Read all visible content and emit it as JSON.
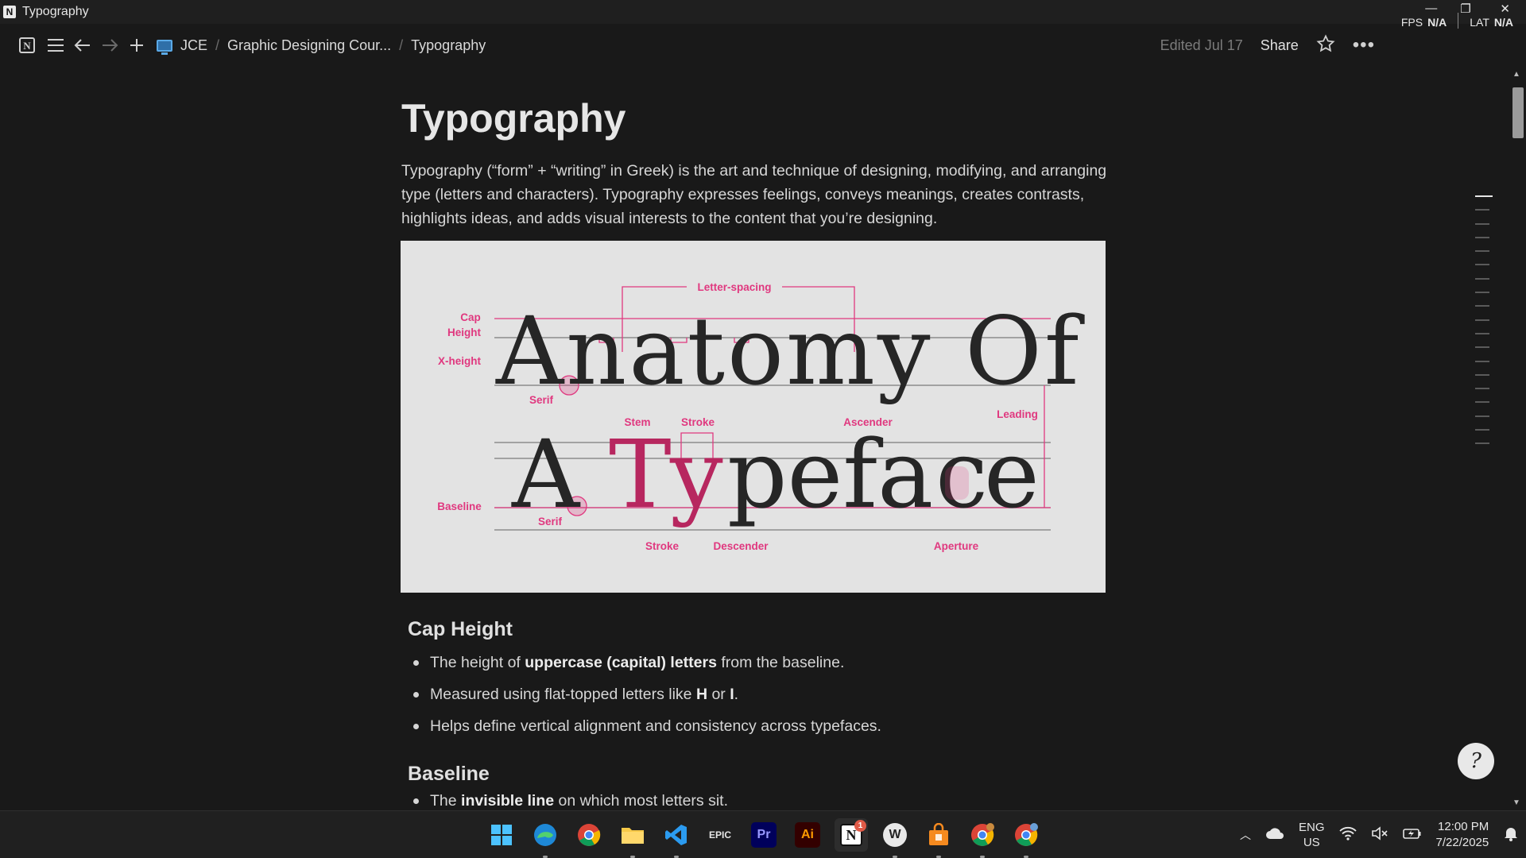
{
  "window": {
    "title": "Typography",
    "app_icon": "N"
  },
  "overlay": {
    "fps_label": "FPS",
    "fps_value": "N/A",
    "lat_label": "LAT",
    "lat_value": "N/A"
  },
  "toolbar": {
    "breadcrumbs": [
      "JCE",
      "Graphic Designing Cour...",
      "Typography"
    ],
    "edited": "Edited Jul 17",
    "share": "Share"
  },
  "page": {
    "title": "Typography",
    "intro": "Typography (“form” + “writing” in Greek) is the art and technique of designing, modifying, and arranging type (letters and characters). Typography expresses feelings, conveys meanings, creates contrasts, highlights ideas, and adds  visual interests to the content that you’re designing."
  },
  "figure": {
    "line1": "Anatomy Of",
    "line2_a": "A",
    "line2_T": "T",
    "line2_y": "y",
    "line2_pefa": "pefa",
    "line2_c": "c",
    "line2_e": "e",
    "labels": {
      "letter_spacing": "Letter-spacing",
      "cap": "Cap",
      "height": "Height",
      "x_height": "X-height",
      "serif": "Serif",
      "stem": "Stem",
      "stroke": "Stroke",
      "ascender": "Ascender",
      "leading": "Leading",
      "baseline": "Baseline",
      "descender": "Descender",
      "aperture": "Aperture"
    },
    "accent_color": "#e0387f"
  },
  "sections": {
    "cap_height": {
      "heading": "Cap Height",
      "b1_pre": "The height of ",
      "b1_bold": "uppercase (capital) letters",
      "b1_post": " from the baseline.",
      "b2_pre": "Measured using flat-topped letters like ",
      "b2_H": "H",
      "b2_or": " or ",
      "b2_I": "I",
      "b2_post": ".",
      "b3": "Helps define vertical alignment and consistency across typefaces."
    },
    "baseline": {
      "heading": "Baseline",
      "b1_pre": "The ",
      "b1_bold": "invisible line",
      "b1_post": " on which most letters sit."
    }
  },
  "taskbar": {
    "apps": [
      {
        "name": "start",
        "icon": "windows-logo"
      },
      {
        "name": "edge",
        "icon": "edge-icon"
      },
      {
        "name": "chrome",
        "icon": "chrome-icon"
      },
      {
        "name": "explorer",
        "icon": "folder-icon"
      },
      {
        "name": "vscode",
        "icon": "vscode-icon"
      },
      {
        "name": "epic",
        "label": "EPIC"
      },
      {
        "name": "premiere",
        "label": "Pr"
      },
      {
        "name": "illustrator",
        "label": "Ai"
      },
      {
        "name": "notion",
        "label": "N",
        "badge": "1"
      },
      {
        "name": "wondershare",
        "label": "W"
      },
      {
        "name": "store",
        "icon": "store-icon"
      },
      {
        "name": "chrome-profile-1",
        "icon": "chrome-icon"
      },
      {
        "name": "chrome-profile-2",
        "icon": "chrome-icon"
      }
    ],
    "lang_top": "ENG",
    "lang_bottom": "US",
    "time": "12:00 PM",
    "date": "7/22/2025"
  }
}
